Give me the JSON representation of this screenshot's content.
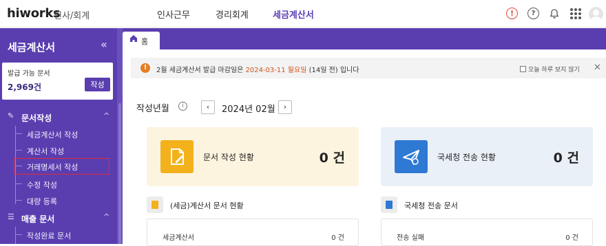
{
  "header": {
    "logo": "hiworks",
    "logo_sub": "인사/회계",
    "nav": [
      "인사근무",
      "경리회계",
      "세금계산서"
    ],
    "active_nav": "세금계산서"
  },
  "sidebar": {
    "title": "세금계산서",
    "issue_card": {
      "label": "발급 가능 문서",
      "count": "2,969건",
      "button": "작성"
    },
    "sections": [
      {
        "label": "문서작성",
        "items": [
          "세금계산서 작성",
          "계산서 작성",
          "거래명세서 작성",
          "수정 작성",
          "대량 등록"
        ]
      },
      {
        "label": "매출 문서",
        "items": [
          "작성완료 문서"
        ]
      }
    ],
    "highlighted_item": "거래명세서 작성"
  },
  "tabs": [
    {
      "label": "홈"
    }
  ],
  "notice": {
    "text_before": "2월 세금계산서 발급 마감일은 ",
    "date": "2024-03-11 월요일",
    "text_after": " (14일 전) 입니다",
    "checkbox_label": "오늘 하루 보지 않기"
  },
  "period": {
    "label": "작성년월",
    "value": "2024년 02월"
  },
  "stats": [
    {
      "label": "문서 작성 현황",
      "count": "0 건",
      "color": "#f3b11c"
    },
    {
      "label": "국세청 전송 현황",
      "count": "0 건",
      "color": "#2e79d3"
    }
  ],
  "subsections": [
    {
      "label": "(세금)계산서 문서 현황",
      "rows": [
        {
          "name": "세금계산서",
          "value": "0 건"
        }
      ]
    },
    {
      "label": "국세청 전송 문서",
      "rows": [
        {
          "name": "전송 실패",
          "value": "0 건"
        }
      ]
    }
  ],
  "colors": {
    "brand": "#5a3eb0",
    "alert": "#e0483b",
    "highlight_outline": "#e02a3a"
  }
}
